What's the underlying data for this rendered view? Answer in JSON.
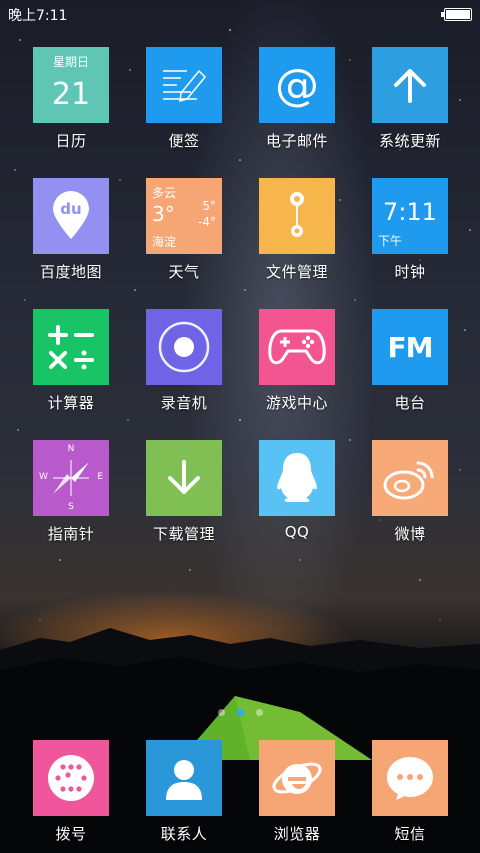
{
  "status_bar": {
    "time": "晚上7:11"
  },
  "apps": [
    {
      "label": "日历",
      "color": "#5fc6b6"
    },
    {
      "label": "便签",
      "color": "#1e9aef"
    },
    {
      "label": "电子邮件",
      "color": "#1e9aef"
    },
    {
      "label": "系统更新",
      "color": "#2d9fe0"
    },
    {
      "label": "百度地图",
      "color": "#9291f2"
    },
    {
      "label": "天气",
      "color": "#f5a674"
    },
    {
      "label": "文件管理",
      "color": "#f6b64c"
    },
    {
      "label": "时钟",
      "color": "#1e9aef"
    },
    {
      "label": "计算器",
      "color": "#19c466"
    },
    {
      "label": "录音机",
      "color": "#6f63e6"
    },
    {
      "label": "游戏中心",
      "color": "#f25590"
    },
    {
      "label": "电台",
      "color": "#1e9aef"
    },
    {
      "label": "指南针",
      "color": "#b85acb"
    },
    {
      "label": "下载管理",
      "color": "#7fbf53"
    },
    {
      "label": "QQ",
      "color": "#59c2f4"
    },
    {
      "label": "微博",
      "color": "#f7a978"
    }
  ],
  "calendar": {
    "weekday": "星期日",
    "day": "21"
  },
  "weather": {
    "condition": "多云",
    "temp": "3°",
    "high": "5°",
    "low": "-4°",
    "city": "海淀"
  },
  "clock": {
    "time": "7:11",
    "period": "下午"
  },
  "baidu_map": {
    "logo": "du"
  },
  "radio": {
    "logo": "FM"
  },
  "compass": {
    "n": "N",
    "s": "S",
    "e": "E",
    "w": "W"
  },
  "page_indicator": {
    "count": 3,
    "active": 1
  },
  "dock": [
    {
      "label": "拨号",
      "color": "#f0569b"
    },
    {
      "label": "联系人",
      "color": "#2a98d8"
    },
    {
      "label": "浏览器",
      "color": "#f5a674"
    },
    {
      "label": "短信",
      "color": "#f5a674"
    }
  ]
}
